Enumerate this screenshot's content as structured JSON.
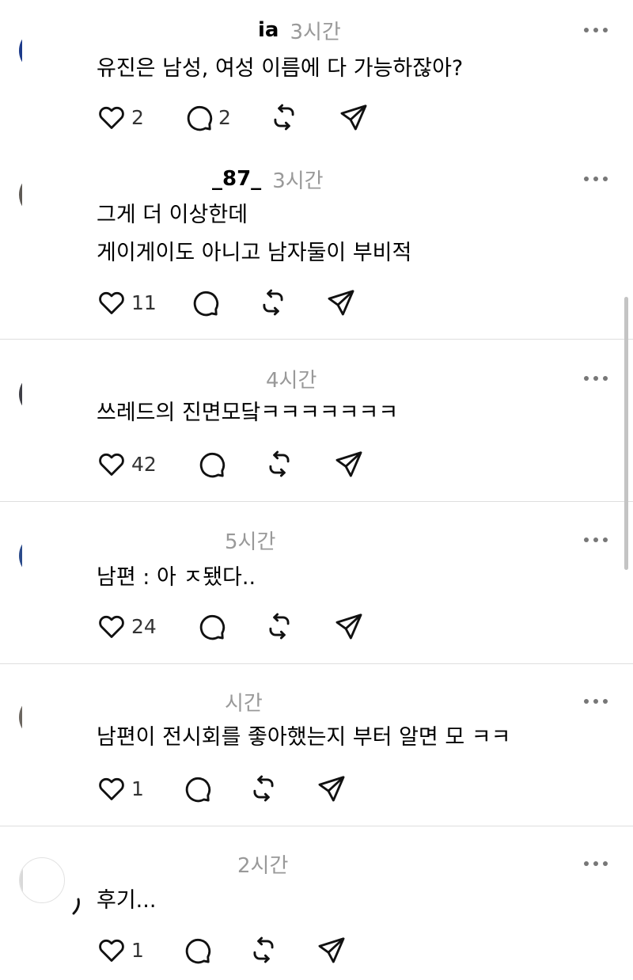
{
  "posts": [
    {
      "username": "ia",
      "time": "3시간",
      "lines": [
        "유진은 남성, 여성 이름에 다 가능하잖아?"
      ],
      "likes": "2",
      "replies": "2",
      "avatar_color": "#1c3a8a"
    },
    {
      "username": "_87_",
      "time": "3시간",
      "lines": [
        "그게 더 이상한데",
        "게이게이도 아니고 남자둘이 부비적"
      ],
      "likes": "11",
      "replies": "",
      "avatar_color": "#5e5a55"
    },
    {
      "username": "",
      "time": "4시간",
      "lines": [
        "쓰레드의 진면모닼ㅋㅋㅋㅋㅋㅋㅋ"
      ],
      "likes": "42",
      "replies": "",
      "avatar_color": "#3f3f46"
    },
    {
      "username": "",
      "time": "5시간",
      "lines": [
        "남편 : 아 ㅈ됐다.."
      ],
      "likes": "24",
      "replies": "",
      "avatar_color": "#2a4a8a"
    },
    {
      "username": "",
      "time": "시간",
      "lines": [
        "남편이 전시회를 좋아했는지 부터 알면 모 ㅋㅋ"
      ],
      "likes": "1",
      "replies": "",
      "avatar_color": "#6b6660"
    },
    {
      "username": "",
      "time": "2시간",
      "lines": [
        "후기..."
      ],
      "likes": "1",
      "replies": "",
      "avatar_color": "#d9d9d9"
    }
  ]
}
